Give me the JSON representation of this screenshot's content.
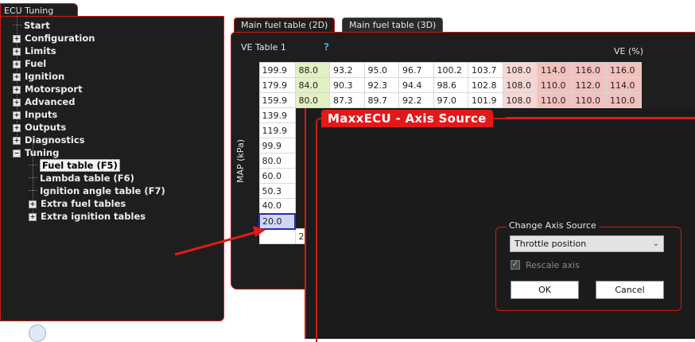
{
  "left_panel": {
    "tab_label": "ECU Tuning",
    "tree": [
      {
        "label": "Start",
        "kind": "leaf",
        "level": 0
      },
      {
        "label": "Configuration",
        "kind": "collapsed",
        "level": 0
      },
      {
        "label": "Limits",
        "kind": "collapsed",
        "level": 0
      },
      {
        "label": "Fuel",
        "kind": "collapsed",
        "level": 0
      },
      {
        "label": "Ignition",
        "kind": "collapsed",
        "level": 0
      },
      {
        "label": "Motorsport",
        "kind": "collapsed",
        "level": 0
      },
      {
        "label": "Advanced",
        "kind": "collapsed",
        "level": 0
      },
      {
        "label": "Inputs",
        "kind": "collapsed",
        "level": 0
      },
      {
        "label": "Outputs",
        "kind": "collapsed",
        "level": 0
      },
      {
        "label": "Diagnostics",
        "kind": "collapsed",
        "level": 0
      },
      {
        "label": "Tuning",
        "kind": "expanded",
        "level": 0
      },
      {
        "label": "Fuel table (F5)",
        "kind": "leaf",
        "level": 1,
        "selected": true
      },
      {
        "label": "Lambda table (F6)",
        "kind": "leaf",
        "level": 1
      },
      {
        "label": "Ignition angle table (F7)",
        "kind": "leaf",
        "level": 1
      },
      {
        "label": "Extra fuel tables",
        "kind": "collapsed",
        "level": 1
      },
      {
        "label": "Extra ignition tables",
        "kind": "collapsed",
        "level": 1
      }
    ]
  },
  "main_panel": {
    "tabs": [
      "Main fuel table (2D)",
      "Main fuel table (3D)"
    ],
    "active_tab": 0,
    "table_title": "VE Table 1",
    "help_glyph": "?",
    "ve_unit_label": "VE (%)",
    "y_axis_label": "MAP (kPa)",
    "selected_row_index": 10,
    "rows": [
      {
        "map": "199.9",
        "values": [
          "88.0",
          "93.2",
          "95.0",
          "96.7",
          "100.2",
          "103.7",
          "108.0",
          "114.0",
          "116.0",
          "116.0"
        ]
      },
      {
        "map": "179.9",
        "values": [
          "84.0",
          "90.3",
          "92.3",
          "94.4",
          "98.6",
          "102.8",
          "108.0",
          "110.0",
          "112.0",
          "114.0"
        ]
      },
      {
        "map": "159.9",
        "values": [
          "80.0",
          "87.3",
          "89.7",
          "92.2",
          "97.0",
          "101.9",
          "108.0",
          "110.0",
          "110.0",
          "110.0"
        ]
      },
      {
        "map": "139.9",
        "values": []
      },
      {
        "map": "119.9",
        "values": []
      },
      {
        "map": "99.9",
        "values": []
      },
      {
        "map": "80.0",
        "values": []
      },
      {
        "map": "60.0",
        "values": []
      },
      {
        "map": "50.3",
        "values": []
      },
      {
        "map": "40.0",
        "values": []
      },
      {
        "map": "20.0",
        "values": []
      },
      {
        "map": "",
        "values": [
          "2"
        ]
      }
    ],
    "cell_colors": {
      "green": "#e3f0c4",
      "light_pink": "#f6d7d3",
      "pink": "#f1c1bd"
    }
  },
  "dialog": {
    "title": "MaxxECU - Axis Source",
    "group_label": "Change Axis Source",
    "selected_source": "Throttle position",
    "rescale_label": "Rescale axis",
    "rescale_checked": true,
    "rescale_enabled": false,
    "ok_label": "OK",
    "cancel_label": "Cancel"
  },
  "colors": {
    "accent_red": "#e31818",
    "panel_bg": "#1e1e1e",
    "help_blue": "#3aa5e8"
  }
}
